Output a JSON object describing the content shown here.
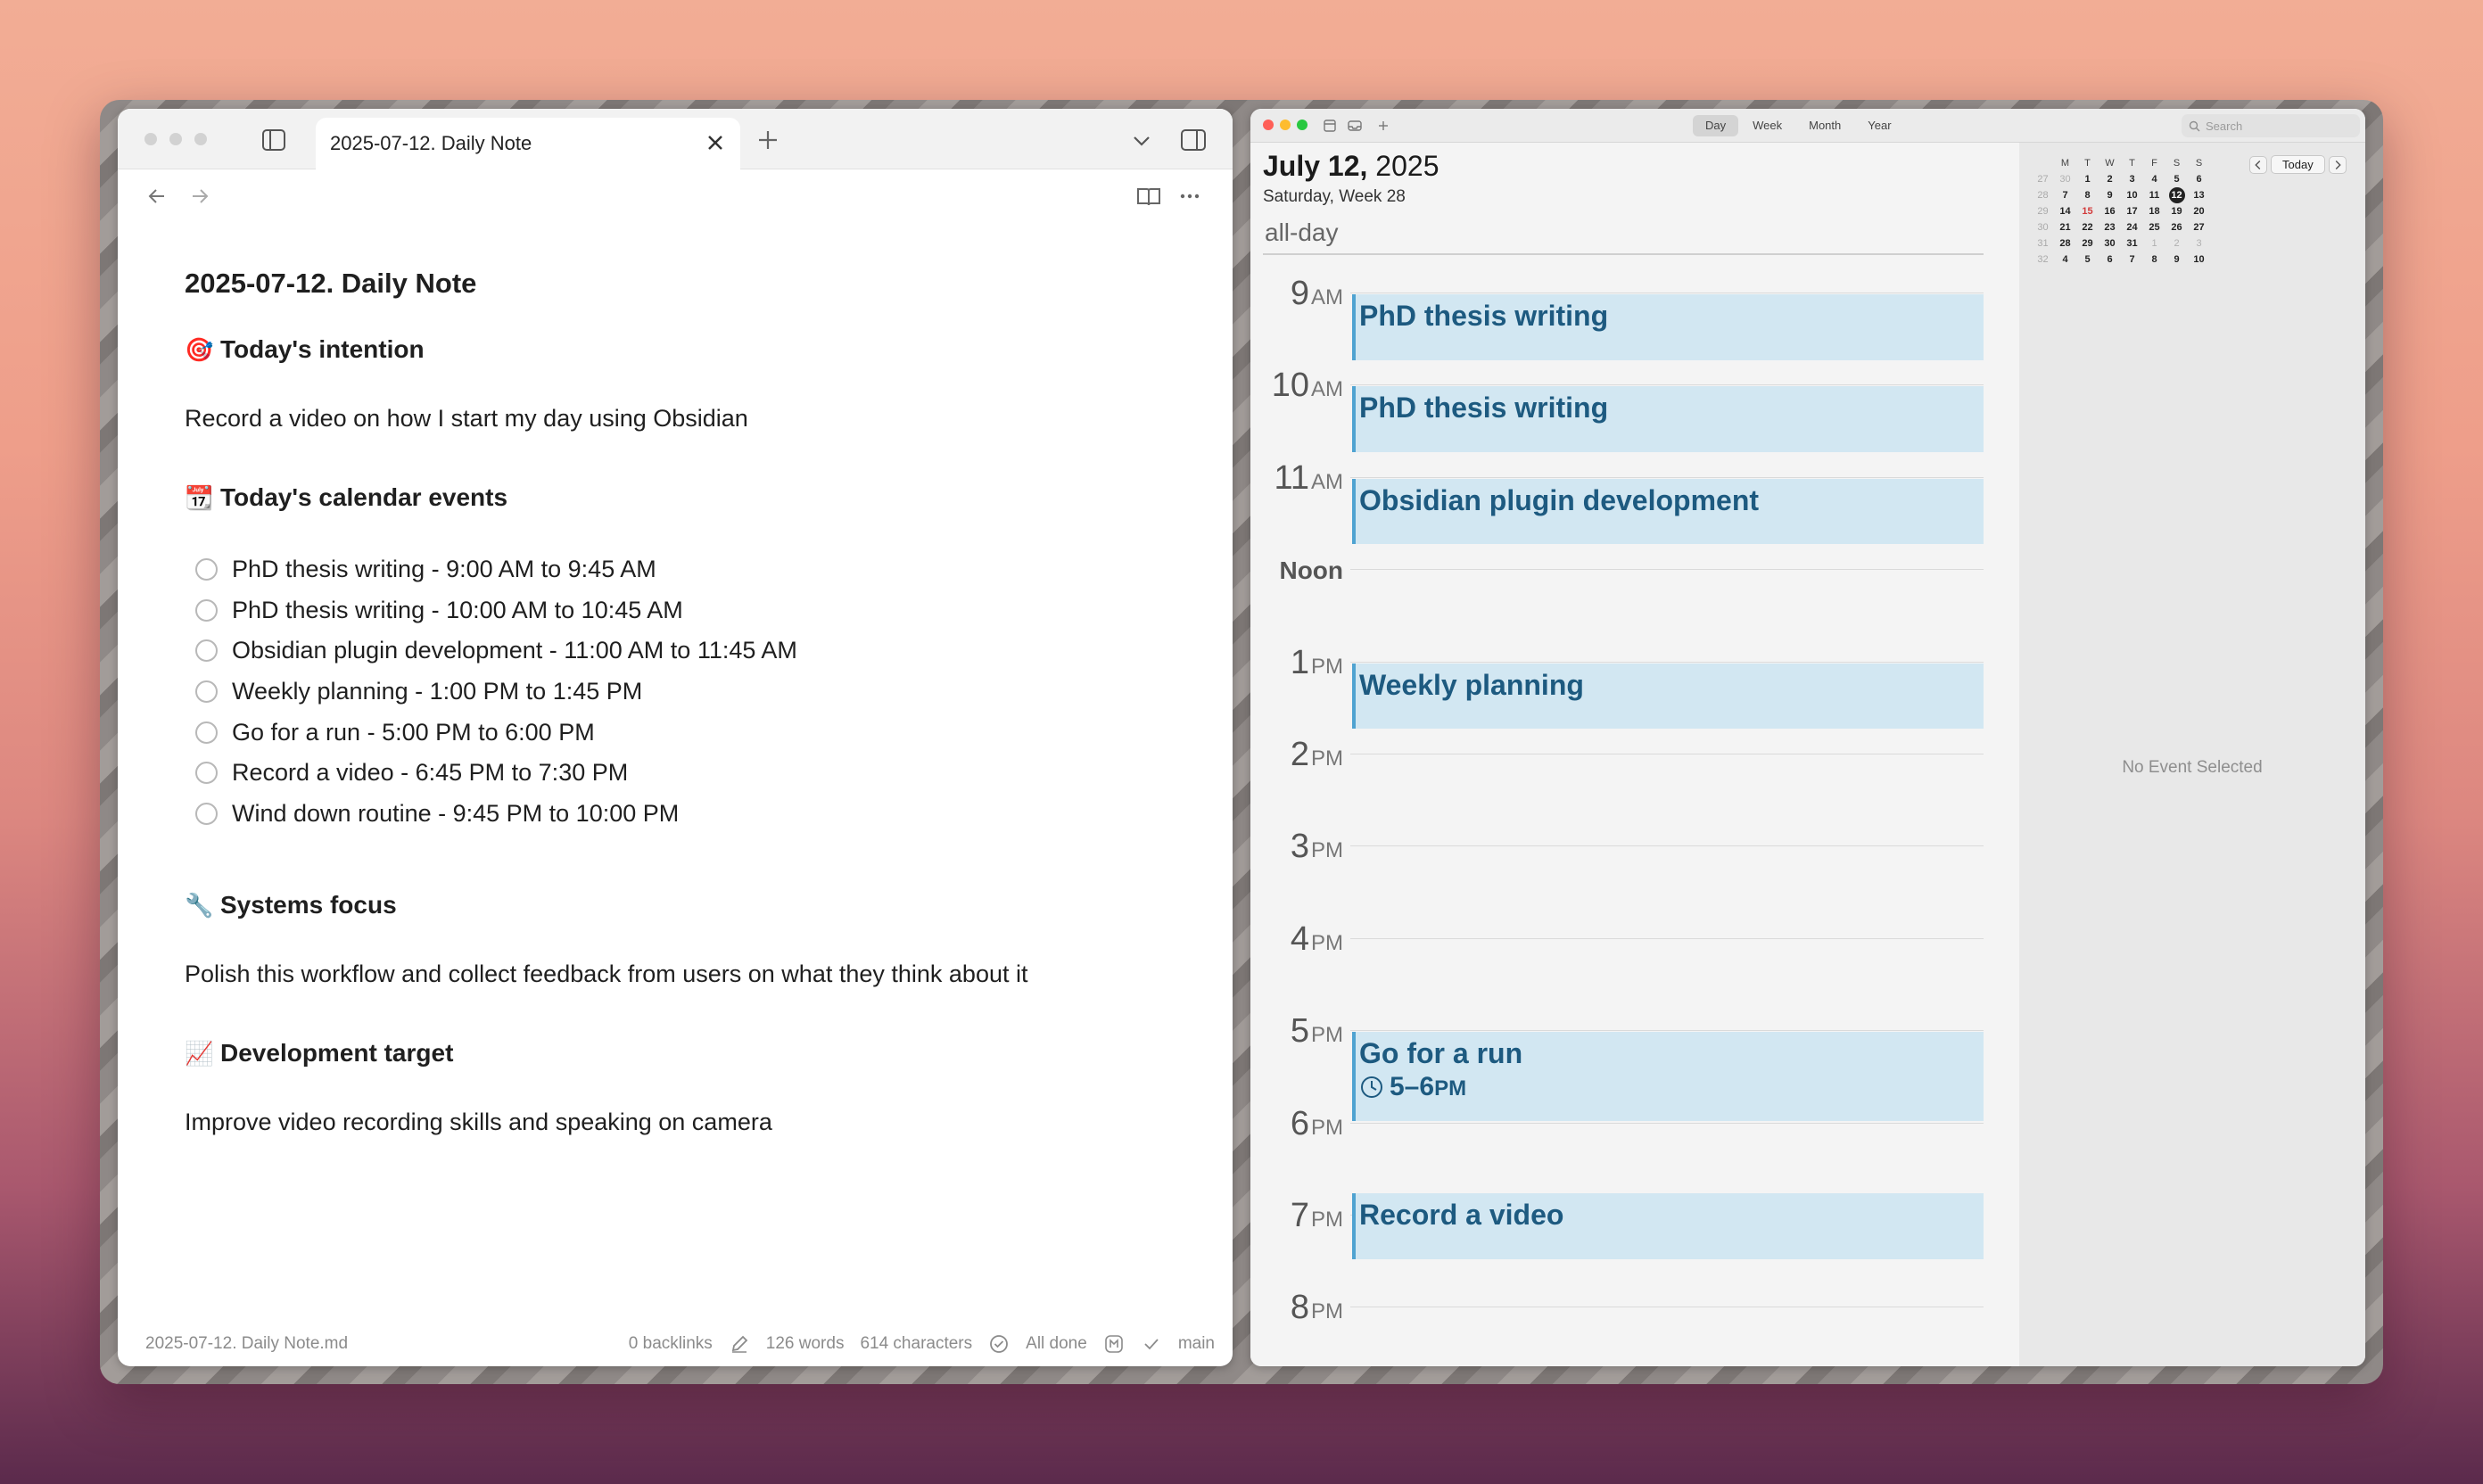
{
  "obsidian": {
    "tab_title": "2025-07-12. Daily Note",
    "note": {
      "title": "2025-07-12. Daily Note",
      "sections": [
        {
          "emoji": "🎯",
          "heading": "Today's intention",
          "text": "Record a video on how I start my day using Obsidian"
        },
        {
          "emoji": "📆",
          "heading": "Today's calendar events",
          "tasks": [
            "PhD thesis writing - 9:00 AM to 9:45 AM",
            "PhD thesis writing - 10:00 AM to 10:45 AM",
            "Obsidian plugin development - 11:00 AM to 11:45 AM",
            "Weekly planning - 1:00 PM to 1:45 PM",
            "Go for a run - 5:00 PM to 6:00 PM",
            "Record a video - 6:45 PM to 7:30 PM",
            "Wind down routine - 9:45 PM to 10:00 PM"
          ]
        },
        {
          "emoji": "🔧",
          "heading": "Systems focus",
          "text": "Polish this workflow and collect feedback from users on what they think about it"
        },
        {
          "emoji": "📈",
          "heading": "Development target",
          "text": "Improve video recording skills and speaking on camera"
        }
      ]
    },
    "status": {
      "file": "2025-07-12. Daily Note.md",
      "backlinks": "0 backlinks",
      "words": "126 words",
      "characters": "614 characters",
      "sync": "All done",
      "branch": "main"
    }
  },
  "calendar": {
    "views": [
      "Day",
      "Week",
      "Month",
      "Year"
    ],
    "active_view": "Day",
    "search_placeholder": "Search",
    "date_bold": "July 12,",
    "date_year": "2025",
    "subtitle": "Saturday, Week 28",
    "allday_label": "all-day",
    "hours": [
      {
        "num": "9",
        "suffix": "AM"
      },
      {
        "num": "10",
        "suffix": "AM"
      },
      {
        "num": "11",
        "suffix": "AM"
      },
      {
        "num": "Noon",
        "suffix": ""
      },
      {
        "num": "1",
        "suffix": "PM"
      },
      {
        "num": "2",
        "suffix": "PM"
      },
      {
        "num": "3",
        "suffix": "PM"
      },
      {
        "num": "4",
        "suffix": "PM"
      },
      {
        "num": "5",
        "suffix": "PM"
      },
      {
        "num": "6",
        "suffix": "PM"
      },
      {
        "num": "7",
        "suffix": "PM"
      },
      {
        "num": "8",
        "suffix": "PM"
      }
    ],
    "events": [
      {
        "title": "PhD thesis writing",
        "start": "9:00",
        "end": "9:45"
      },
      {
        "title": "PhD thesis writing",
        "start": "10:00",
        "end": "10:45"
      },
      {
        "title": "Obsidian plugin development",
        "start": "11:00",
        "end": "11:45"
      },
      {
        "title": "Weekly planning",
        "start": "13:00",
        "end": "13:45"
      },
      {
        "title": "Go for a run",
        "start": "17:00",
        "end": "18:00",
        "time_label": "5–6",
        "time_suffix": "PM"
      },
      {
        "title": "Record a video",
        "start": "18:45",
        "end": "19:30"
      },
      {
        "title": "",
        "start": "21:45",
        "end": "22:00"
      }
    ],
    "mini_calendar": {
      "weekdays": [
        "M",
        "T",
        "W",
        "T",
        "F",
        "S",
        "S"
      ],
      "weeks": [
        {
          "wk": "27",
          "days": [
            "30",
            "1",
            "2",
            "3",
            "4",
            "5",
            "6"
          ]
        },
        {
          "wk": "28",
          "days": [
            "7",
            "8",
            "9",
            "10",
            "11",
            "12",
            "13"
          ]
        },
        {
          "wk": "29",
          "days": [
            "14",
            "15",
            "16",
            "17",
            "18",
            "19",
            "20"
          ]
        },
        {
          "wk": "30",
          "days": [
            "21",
            "22",
            "23",
            "24",
            "25",
            "26",
            "27"
          ]
        },
        {
          "wk": "31",
          "days": [
            "28",
            "29",
            "30",
            "31",
            "1",
            "2",
            "3"
          ]
        },
        {
          "wk": "32",
          "days": [
            "4",
            "5",
            "6",
            "7",
            "8",
            "9",
            "10"
          ]
        }
      ],
      "selected": "12",
      "today_label": "Today"
    },
    "no_event_text": "No Event Selected"
  }
}
